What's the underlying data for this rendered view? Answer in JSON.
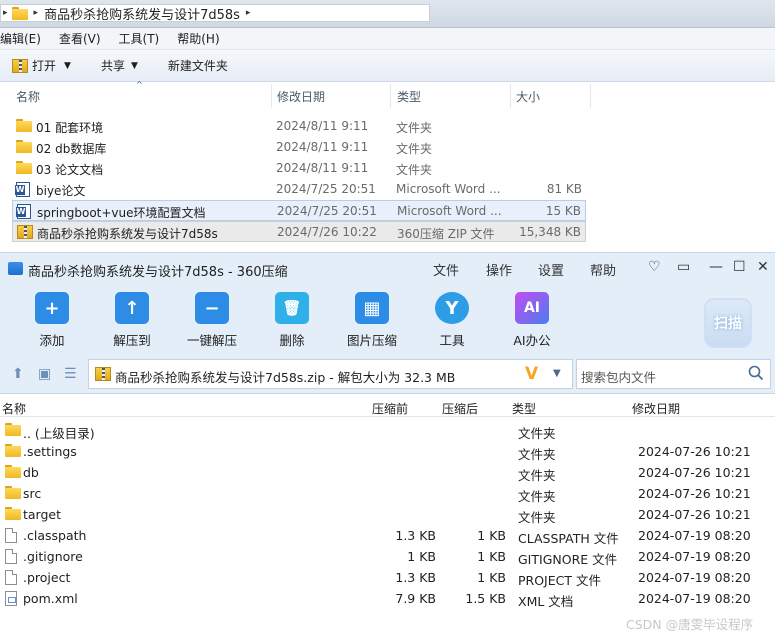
{
  "explorer": {
    "breadcrumb": "商品秒杀抢购系统发与设计7d58s",
    "menu": [
      "编辑(E)",
      "查看(V)",
      "工具(T)",
      "帮助(H)"
    ],
    "toolbar": {
      "open": "打开",
      "share": "共享",
      "new_folder": "新建文件夹"
    },
    "columns": {
      "name": "名称",
      "date": "修改日期",
      "type": "类型",
      "size": "大小"
    },
    "rows": [
      {
        "name": "01 配套环境",
        "date": "2024/8/11 9:11",
        "type": "文件夹",
        "size": "",
        "icon": "folder-icon"
      },
      {
        "name": "02 db数据库",
        "date": "2024/8/11 9:11",
        "type": "文件夹",
        "size": "",
        "icon": "folder-icon"
      },
      {
        "name": "03 论文文档",
        "date": "2024/8/11 9:11",
        "type": "文件夹",
        "size": "",
        "icon": "folder-icon"
      },
      {
        "name": "biye论文",
        "date": "2024/7/25 20:51",
        "type": "Microsoft Word ...",
        "size": "81 KB",
        "icon": "word-icon"
      },
      {
        "name": "springboot+vue环境配置文档",
        "date": "2024/7/25 20:51",
        "type": "Microsoft Word ...",
        "size": "15 KB",
        "icon": "word-icon"
      },
      {
        "name": "商品秒杀抢购系统发与设计7d58s",
        "date": "2024/7/26 10:22",
        "type": "360压缩 ZIP 文件",
        "size": "15,348 KB",
        "icon": "zip-icon"
      }
    ]
  },
  "zip": {
    "title": "商品秒杀抢购系统发与设计7d58s - 360压缩",
    "menu": [
      "文件",
      "操作",
      "设置",
      "帮助"
    ],
    "tools": [
      {
        "label": "添加",
        "icon": "add-icon",
        "color": "#2d8ce6",
        "glyph": "+"
      },
      {
        "label": "解压到",
        "icon": "extract-to-icon",
        "color": "#2d8ce6",
        "glyph": "↑"
      },
      {
        "label": "一键解压",
        "icon": "one-click-extract-icon",
        "color": "#2d8ce6",
        "glyph": "−"
      },
      {
        "label": "删除",
        "icon": "delete-icon",
        "color": "#2fb0e8",
        "glyph": "🗑"
      },
      {
        "label": "图片压缩",
        "icon": "image-compress-icon",
        "color": "#2d8ce6",
        "glyph": "▦"
      },
      {
        "label": "工具",
        "icon": "tools-icon",
        "color": "#2d9ee6",
        "glyph": "Y"
      },
      {
        "label": "AI办公",
        "icon": "ai-office-icon",
        "color": "#7b5ce8",
        "glyph": "AI"
      }
    ],
    "scan_label": "扫描",
    "address": "商品秒杀抢购系统发与设计7d58s.zip - 解包大小为 32.3 MB",
    "search_placeholder": "搜索包内文件",
    "columns": {
      "name": "名称",
      "compressed_before": "压缩前",
      "compressed_after": "压缩后",
      "type": "类型",
      "date": "修改日期"
    },
    "rows": [
      {
        "name": ".. (上级目录)",
        "before": "",
        "after": "",
        "type": "文件夹",
        "date": "",
        "icon": "folder-icon"
      },
      {
        "name": ".settings",
        "before": "",
        "after": "",
        "type": "文件夹",
        "date": "2024-07-26 10:21",
        "icon": "folder-icon"
      },
      {
        "name": "db",
        "before": "",
        "after": "",
        "type": "文件夹",
        "date": "2024-07-26 10:21",
        "icon": "folder-icon"
      },
      {
        "name": "src",
        "before": "",
        "after": "",
        "type": "文件夹",
        "date": "2024-07-26 10:21",
        "icon": "folder-icon"
      },
      {
        "name": "target",
        "before": "",
        "after": "",
        "type": "文件夹",
        "date": "2024-07-26 10:21",
        "icon": "folder-icon"
      },
      {
        "name": ".classpath",
        "before": "1.3 KB",
        "after": "1 KB",
        "type": "CLASSPATH 文件",
        "date": "2024-07-19 08:20",
        "icon": "file-icon"
      },
      {
        "name": ".gitignore",
        "before": "1 KB",
        "after": "1 KB",
        "type": "GITIGNORE 文件",
        "date": "2024-07-19 08:20",
        "icon": "file-icon"
      },
      {
        "name": ".project",
        "before": "1.3 KB",
        "after": "1 KB",
        "type": "PROJECT 文件",
        "date": "2024-07-19 08:20",
        "icon": "file-icon"
      },
      {
        "name": "pom.xml",
        "before": "7.9 KB",
        "after": "1.5 KB",
        "type": "XML 文档",
        "date": "2024-07-19 08:20",
        "icon": "xml-icon"
      }
    ]
  },
  "watermark": "CSDN @唐雯毕设程序"
}
